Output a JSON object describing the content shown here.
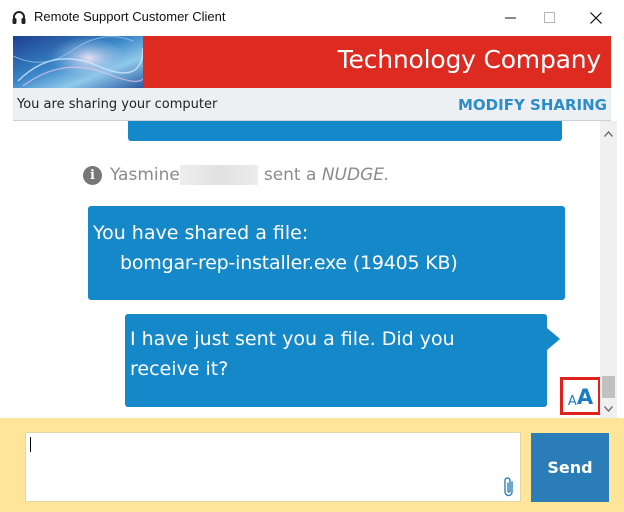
{
  "window": {
    "title": "Remote Support Customer Client",
    "icon": "headset-icon"
  },
  "banner": {
    "company": "Technology Company",
    "brand_color": "#de2b22"
  },
  "share_bar": {
    "status_text": "You are sharing your computer",
    "modify_label": "MODIFY SHARING",
    "accent_color": "#2d8dc9"
  },
  "chat": {
    "nudge": {
      "name": "Yasmine",
      "text": "sent a",
      "action": "NUDGE."
    },
    "file_message": {
      "line1": "You have shared a file:",
      "file": "bomgar-rep-installer.exe (19405 KB)"
    },
    "message": {
      "line1": "I have just sent you a file.  Did you",
      "line2": "receive it?"
    },
    "font_size_button": {
      "small": "A",
      "big": "A"
    },
    "bubble_color": "#1488c8"
  },
  "composer": {
    "value": "",
    "send_label": "Send",
    "attach_icon": "paperclip-icon"
  }
}
